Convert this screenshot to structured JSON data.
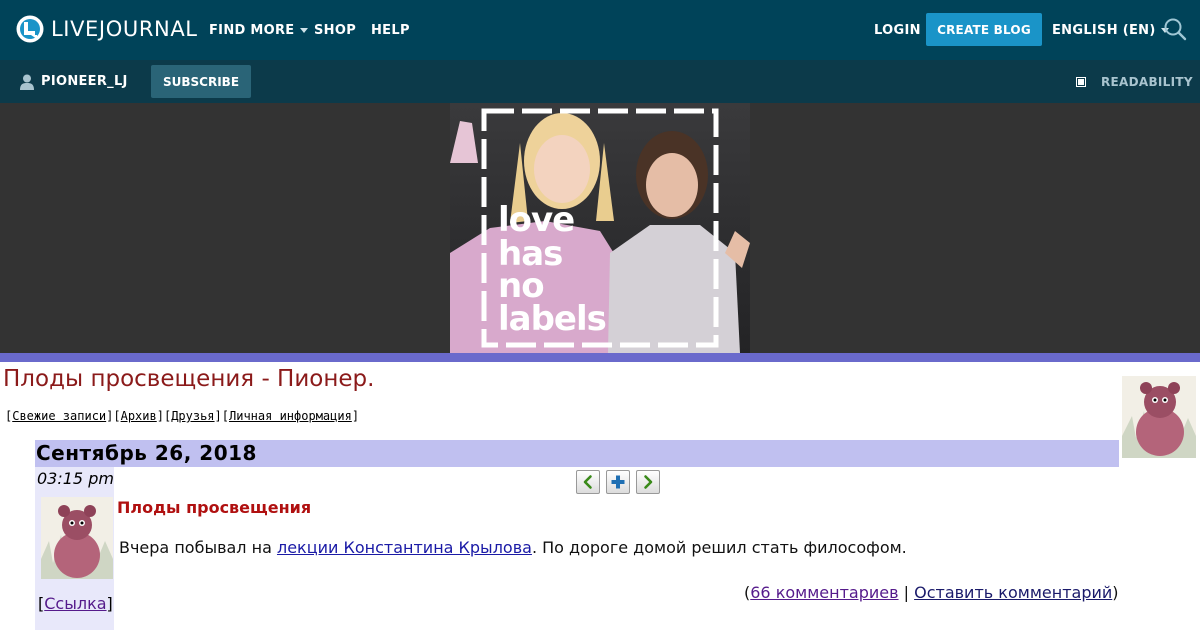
{
  "header": {
    "logo_text": "LIVEJOURNAL",
    "nav": {
      "find_more": "FIND MORE",
      "shop": "SHOP",
      "help": "HELP",
      "login": "LOGIN",
      "create_blog": "CREATE BLOG",
      "language": "ENGLISH (EN)"
    },
    "colors": {
      "bar": "#004359",
      "accent": "#1a94c8"
    }
  },
  "userbar": {
    "username": "PIONEER_LJ",
    "subscribe": "SUBSCRIBE",
    "readability": "READABILITY",
    "colors": {
      "bar": "#0c3a4a",
      "button": "#2a6477"
    }
  },
  "banner": {
    "text_lines": [
      "love",
      "has",
      "no",
      "labels"
    ]
  },
  "journal": {
    "title": "Плоды просвещения - Пионер.",
    "nav_links": [
      "Свежие записи",
      "Архив",
      "Друзья",
      "Личная информация"
    ],
    "colors": {
      "title": "#8b1a1a",
      "date_bar": "#c0c0f0",
      "divider": "#6a6acc"
    }
  },
  "post": {
    "date": "Сентябрь 26, 2018",
    "time": "03:15 pm",
    "title": "Плоды просвещения",
    "body_before": "Вчера побывал на ",
    "body_link": "лекции Константина Крылова",
    "body_after": ". По дороге домой решил стать философом.",
    "permalink": "Ссылка",
    "comments_count_link": "66 комментариев",
    "leave_comment": "Оставить комментарий",
    "arrow_icons": [
      "prev-arrow-icon",
      "memories-plus-icon",
      "next-arrow-icon"
    ]
  }
}
